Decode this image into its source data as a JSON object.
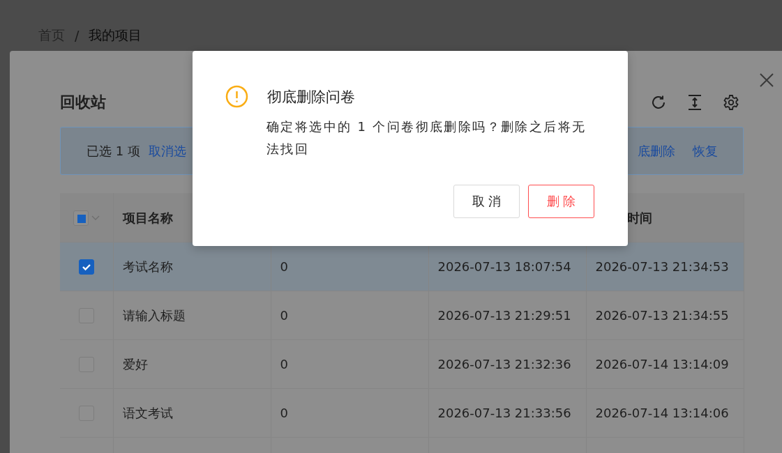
{
  "breadcrumb": {
    "items": [
      {
        "label": "首页",
        "current": false
      },
      {
        "label": "我的项目",
        "current": true
      }
    ],
    "separator": "/"
  },
  "drawer": {
    "title": "回收站",
    "toolbar": [
      {
        "kind": "reload"
      },
      {
        "kind": "density"
      },
      {
        "kind": "settings"
      }
    ]
  },
  "alert": {
    "selected_text": "已选 1 项",
    "left_actions": [
      "取消选"
    ],
    "right_actions": [
      "底删除",
      "恢复"
    ]
  },
  "table": {
    "header_checkbox": {
      "indeterminate": true
    },
    "columns": {
      "column_2": "项目名称",
      "column_5": "时间"
    },
    "rows": [
      {
        "checked": true,
        "selected": true,
        "cells": [
          "考试名称",
          "0",
          "2026-07-13 18:07:54",
          "2026-07-13 21:34:53"
        ]
      },
      {
        "checked": false,
        "selected": false,
        "cells": [
          "请输入标题",
          "0",
          "2026-07-13 21:29:51",
          "2026-07-13 21:34:55"
        ]
      },
      {
        "checked": false,
        "selected": false,
        "cells": [
          "爱好",
          "0",
          "2026-07-13 21:32:36",
          "2026-07-14 13:14:09"
        ]
      },
      {
        "checked": false,
        "selected": false,
        "cells": [
          "语文考试",
          "0",
          "2026-07-13 21:33:56",
          "2026-07-14 13:14:06"
        ]
      }
    ]
  },
  "dialog": {
    "title": "彻底删除问卷",
    "message": "确定将选中的 1 个问卷彻底删除吗？删除之后将无法找回",
    "buttons": [
      {
        "label": "取 消",
        "kind": "default"
      },
      {
        "label": "删 除",
        "kind": "danger"
      }
    ]
  }
}
